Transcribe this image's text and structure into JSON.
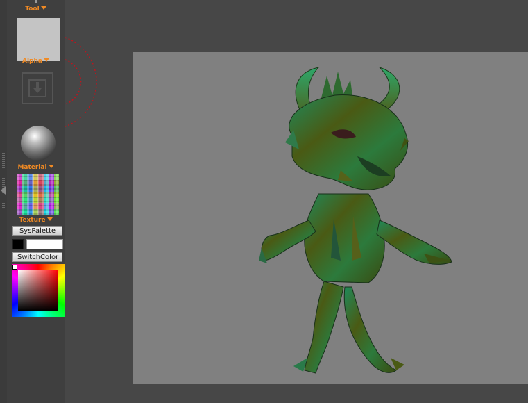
{
  "left_panel": {
    "tool_label": "Tool",
    "alpha_label": "Alpha",
    "material_label": "Material",
    "texture_label": "Texture",
    "syspalette_button": "SysPalette",
    "switchcolor_button": "SwitchColor",
    "main_color": "#000000",
    "secondary_color": "#ffffff"
  },
  "colors": {
    "accent": "#f08a24",
    "panel": "#3f3f3f",
    "canvas_background": "#474747",
    "document_background": "#808080",
    "brush_cursor": "#c0141c"
  },
  "icons": {
    "alpha_import": "arrow-down-icon",
    "tray_toggle": "chevron-left-icon"
  }
}
